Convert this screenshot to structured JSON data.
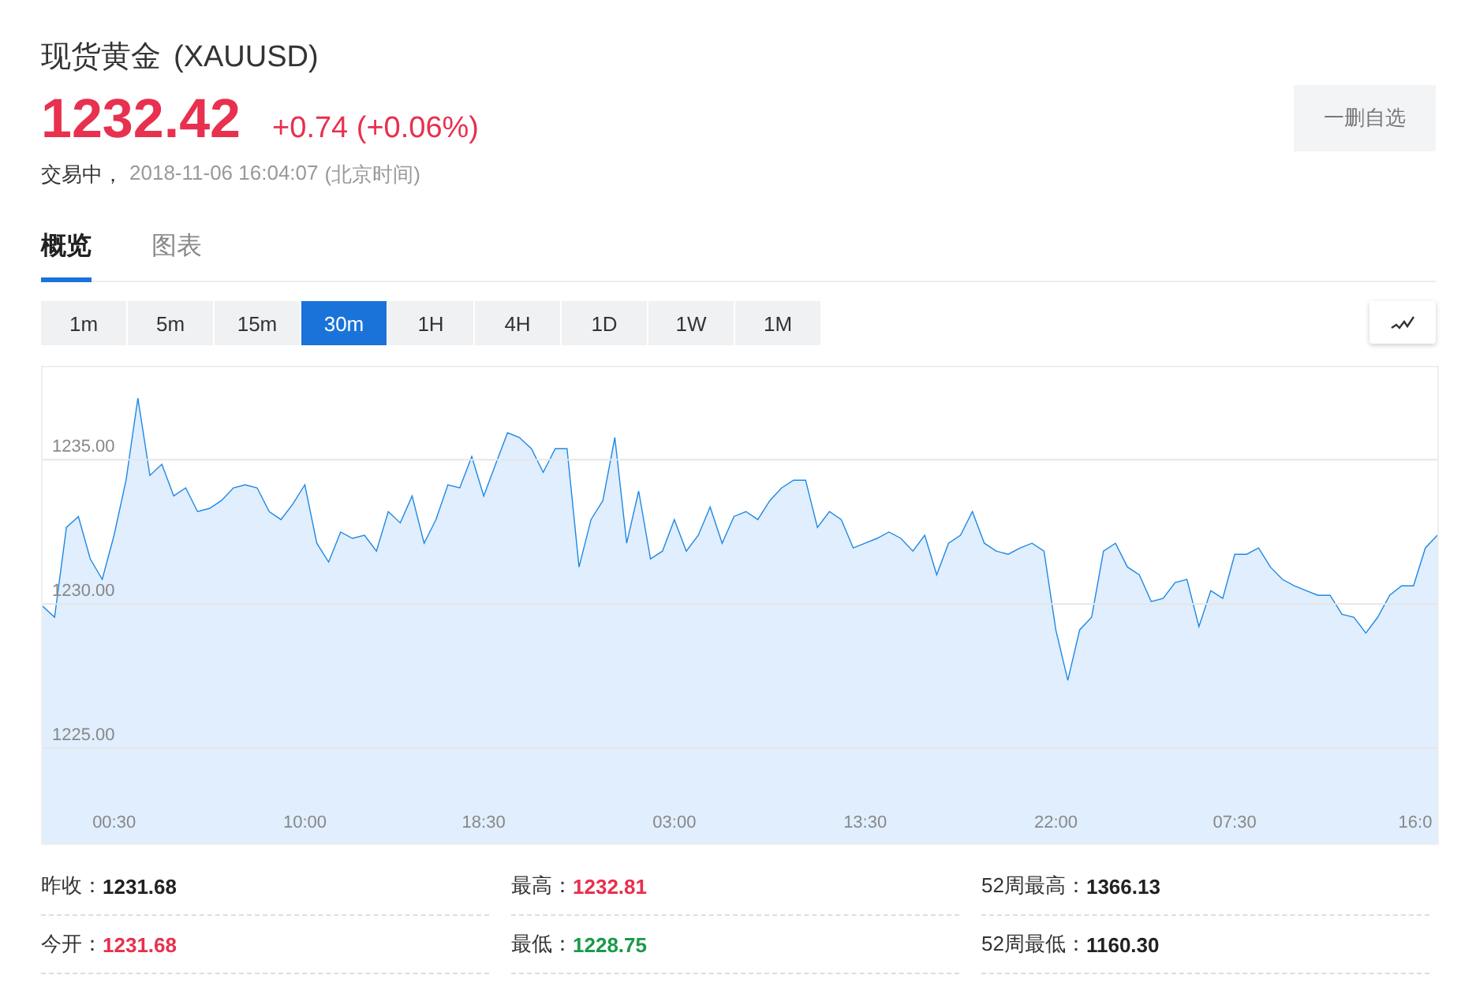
{
  "header": {
    "name": "现货黄金",
    "symbol": "(XAUUSD)",
    "price": "1232.42",
    "change": "+0.74 (+0.06%)",
    "status": "交易中，",
    "time": "2018-11-06 16:04:07",
    "timezone": "(北京时间)",
    "watch_button": "一删自选"
  },
  "tabs": [
    {
      "label": "概览",
      "selected": true
    },
    {
      "label": "图表",
      "selected": false
    }
  ],
  "intervals": [
    {
      "label": "1m",
      "selected": false
    },
    {
      "label": "5m",
      "selected": false
    },
    {
      "label": "15m",
      "selected": false
    },
    {
      "label": "30m",
      "selected": true
    },
    {
      "label": "1H",
      "selected": false
    },
    {
      "label": "4H",
      "selected": false
    },
    {
      "label": "1D",
      "selected": false
    },
    {
      "label": "1W",
      "selected": false
    },
    {
      "label": "1M",
      "selected": false
    }
  ],
  "chart": {
    "chart_data": {
      "type": "area",
      "grid": true,
      "ylim": [
        1221.7,
        1238.2
      ],
      "yticks": [
        {
          "value": 1225,
          "label": "1225.00"
        },
        {
          "value": 1230,
          "label": "1230.00"
        },
        {
          "value": 1235,
          "label": "1235.00"
        }
      ],
      "categories": [
        null,
        null,
        null,
        null,
        null,
        null,
        "00:30",
        null,
        null,
        null,
        null,
        null,
        null,
        null,
        null,
        null,
        null,
        null,
        null,
        null,
        null,
        null,
        "10:00",
        null,
        null,
        null,
        null,
        null,
        null,
        null,
        null,
        null,
        null,
        null,
        null,
        null,
        null,
        "18:30",
        null,
        null,
        null,
        null,
        null,
        null,
        null,
        null,
        null,
        null,
        null,
        null,
        null,
        null,
        null,
        "03:00",
        null,
        null,
        null,
        null,
        null,
        null,
        null,
        null,
        null,
        null,
        null,
        null,
        null,
        null,
        null,
        "13:30",
        null,
        null,
        null,
        null,
        null,
        null,
        null,
        null,
        null,
        null,
        null,
        null,
        null,
        null,
        null,
        "22:00",
        null,
        null,
        null,
        null,
        null,
        null,
        null,
        null,
        null,
        null,
        null,
        null,
        null,
        null,
        "07:30",
        null,
        null,
        null,
        null,
        null,
        null,
        null,
        null,
        null,
        null,
        null,
        null,
        null,
        null,
        null,
        "16:0",
        null
      ],
      "series": [
        {
          "color": "#1e88e5",
          "values": [
            1229.92,
            1229.54,
            1232.65,
            1233.03,
            1231.56,
            1230.85,
            1232.38,
            1234.29,
            1237.13,
            1234.45,
            1234.84,
            1233.74,
            1234.02,
            1233.2,
            1233.31,
            1233.58,
            1234.02,
            1234.13,
            1234.02,
            1233.2,
            1232.92,
            1233.47,
            1234.13,
            1232.1,
            1231.45,
            1232.49,
            1232.27,
            1232.38,
            1231.83,
            1233.2,
            1232.81,
            1233.74,
            1232.1,
            1232.92,
            1234.13,
            1234.02,
            1235.11,
            1233.74,
            1234.84,
            1235.93,
            1235.77,
            1235.38,
            1234.56,
            1235.38,
            1235.38,
            1231.28,
            1232.92,
            1233.58,
            1235.77,
            1232.1,
            1233.91,
            1231.56,
            1231.83,
            1232.92,
            1231.83,
            1232.38,
            1233.36,
            1232.1,
            1233.03,
            1233.2,
            1232.92,
            1233.58,
            1234.02,
            1234.29,
            1234.29,
            1232.65,
            1233.2,
            1232.92,
            1231.94,
            1232.1,
            1232.27,
            1232.49,
            1232.27,
            1231.83,
            1232.38,
            1231.01,
            1232.1,
            1232.38,
            1233.2,
            1232.1,
            1231.83,
            1231.72,
            1231.94,
            1232.1,
            1231.83,
            1229.1,
            1227.35,
            1229.1,
            1229.54,
            1231.83,
            1232.1,
            1231.28,
            1231.01,
            1230.08,
            1230.19,
            1230.74,
            1230.85,
            1229.21,
            1230.46,
            1230.19,
            1231.72,
            1231.72,
            1231.94,
            1231.28,
            1230.85,
            1230.63,
            1230.46,
            1230.3,
            1230.3,
            1229.64,
            1229.54,
            1228.99,
            1229.54,
            1230.3,
            1230.63,
            1230.63,
            1231.94,
            1232.38
          ]
        }
      ]
    }
  },
  "stats": [
    {
      "label": "昨收：",
      "value": "1231.68",
      "color": "#222222"
    },
    {
      "label": "最高：",
      "value": "1232.81",
      "color": "#e8304f"
    },
    {
      "label": "52周最高：",
      "value": "1366.13",
      "color": "#222222"
    },
    {
      "label": "今开：",
      "value": "1231.68",
      "color": "#e8304f"
    },
    {
      "label": "最低：",
      "value": "1228.75",
      "color": "#1a9a4a"
    },
    {
      "label": "52周最低：",
      "value": "1160.30",
      "color": "#222222"
    }
  ]
}
